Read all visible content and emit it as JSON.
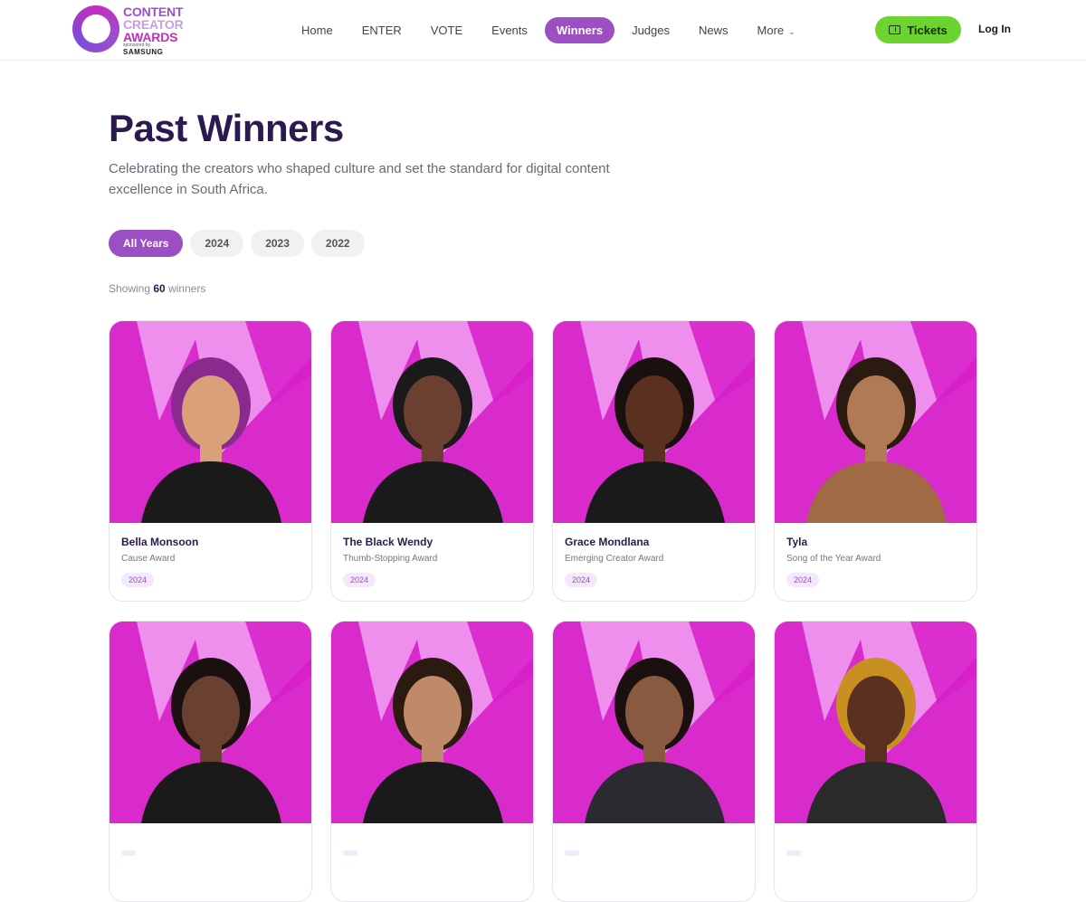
{
  "brand": {
    "logo_line1": "CONTENT",
    "logo_line2": "CREATOR",
    "logo_line3": "AWARDS",
    "sponsored_by": "sponsored by",
    "sponsor": "SAMSUNG",
    "accent": "#9b4fc2",
    "ticket_green": "#6dd42f",
    "photo_pink": "#ee8fee",
    "photo_magenta": "#d61fc8"
  },
  "nav": {
    "items": [
      {
        "label": "Home"
      },
      {
        "label": "ENTER"
      },
      {
        "label": "VOTE"
      },
      {
        "label": "Events"
      },
      {
        "label": "Winners",
        "active": true
      },
      {
        "label": "Judges"
      },
      {
        "label": "News"
      },
      {
        "label": "More",
        "dropdown": true
      }
    ],
    "tickets_label": "Tickets",
    "tickets_icon": "ticket-icon",
    "login_label": "Log In"
  },
  "page": {
    "title": "Past Winners",
    "subtitle": "Celebrating the creators who shaped culture and set the standard for digital content excellence in South Africa."
  },
  "filters": [
    {
      "label": "All Years",
      "active": true
    },
    {
      "label": "2024"
    },
    {
      "label": "2023"
    },
    {
      "label": "2022"
    }
  ],
  "showing": {
    "prefix": "Showing",
    "count": "60",
    "suffix": "winners"
  },
  "winners": [
    {
      "name": "Bella Monsoon",
      "award": "Cause Award",
      "year": "2024",
      "hair": "#8a2a8f",
      "skin": "#d9a07a",
      "shirt": "#1a1a1a"
    },
    {
      "name": "The Black Wendy",
      "award": "Thumb-Stopping Award",
      "year": "2024",
      "hair": "#1a1a1a",
      "skin": "#6b4030",
      "shirt": "#1a1a1a"
    },
    {
      "name": "Grace Mondlana",
      "award": "Emerging Creator Award",
      "year": "2024",
      "hair": "#1a1010",
      "skin": "#5a3020",
      "shirt": "#1a1a1a"
    },
    {
      "name": "Tyla",
      "award": "Song of the Year Award",
      "year": "2024",
      "hair": "#2a1a10",
      "skin": "#b07a55",
      "shirt": "#a06a45"
    },
    {
      "name": "",
      "award": "",
      "year": "",
      "hair": "#1a1010",
      "skin": "#6a4030",
      "shirt": "#1a1a1a"
    },
    {
      "name": "",
      "award": "",
      "year": "",
      "hair": "#2a1a10",
      "skin": "#c08a6a",
      "shirt": "#1a1a1a"
    },
    {
      "name": "",
      "award": "",
      "year": "",
      "hair": "#1a1010",
      "skin": "#8a5a40",
      "shirt": "#2a2a30"
    },
    {
      "name": "",
      "award": "",
      "year": "",
      "hair": "#c89020",
      "skin": "#5a3020",
      "shirt": "#2a2a2a"
    }
  ]
}
